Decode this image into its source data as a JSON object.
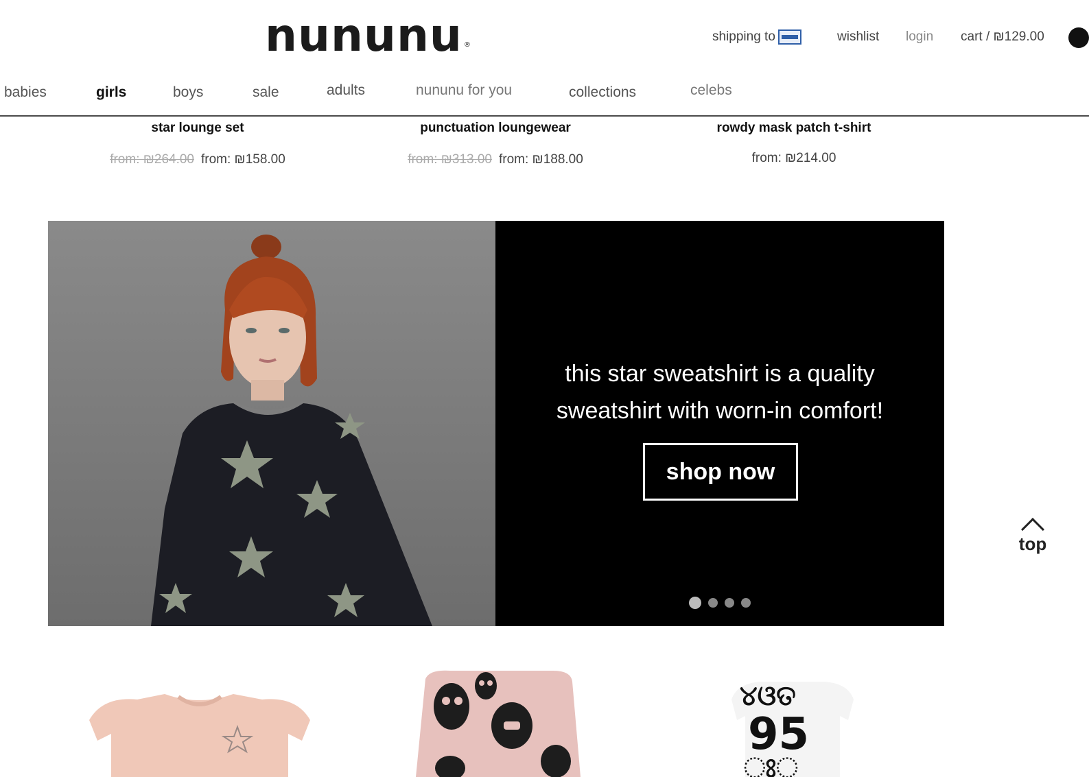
{
  "header": {
    "logo": "nununu",
    "logo_mark": "®",
    "utilities": {
      "shipping_to": "shipping to",
      "wishlist": "wishlist",
      "login": "login",
      "cart": "cart / ₪129.00"
    },
    "nav": [
      {
        "label": "babies"
      },
      {
        "label": "girls"
      },
      {
        "label": "boys"
      },
      {
        "label": "sale"
      },
      {
        "label": "adults"
      },
      {
        "label": "nununu for you"
      },
      {
        "label": "collections"
      },
      {
        "label": "celebs"
      }
    ]
  },
  "products_top": [
    {
      "title": "star lounge set",
      "old_price": "from: ₪264.00",
      "price": "from: ₪158.00"
    },
    {
      "title": "punctuation loungewear",
      "old_price": "from: ₪313.00",
      "price": "from: ₪188.00"
    },
    {
      "title": "rowdy mask patch t-shirt",
      "old_price": "",
      "price": "from: ₪214.00"
    }
  ],
  "banner": {
    "headline_line1": "this star sweatshirt is a quality",
    "headline_line2": "sweatshirt with worn-in comfort!",
    "cta": "shop now",
    "slides": 4,
    "active_slide": 1
  },
  "back_to_top": "top",
  "colors": {
    "banner_bg": "#000000",
    "header_border": "#4a4a4a",
    "text_dark": "#111111"
  }
}
